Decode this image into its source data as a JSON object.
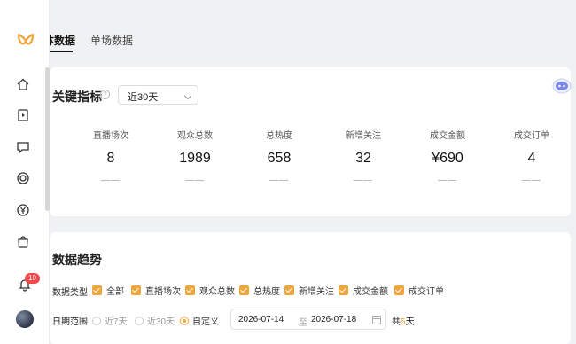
{
  "sidebar": {
    "nav_icons": [
      "home-icon",
      "play-icon",
      "message-icon",
      "target-icon",
      "yuan-icon",
      "shopping-bag-icon"
    ],
    "notification_count": "10"
  },
  "tabs": [
    {
      "label": "整体数据",
      "active": true
    },
    {
      "label": "单场数据",
      "active": false
    }
  ],
  "key_metrics": {
    "title": "关键指标",
    "period_select": "近30天",
    "items": [
      {
        "label": "直播场次",
        "value": "8",
        "change": "——"
      },
      {
        "label": "观众总数",
        "value": "1989",
        "change": "——"
      },
      {
        "label": "总热度",
        "value": "658",
        "change": "——"
      },
      {
        "label": "新增关注",
        "value": "32",
        "change": "——"
      },
      {
        "label": "成交金额",
        "value": "¥690",
        "change": "——"
      },
      {
        "label": "成交订单",
        "value": "4",
        "change": "——"
      }
    ]
  },
  "trend": {
    "title": "数据趋势",
    "type_label": "数据类型",
    "types": [
      {
        "label": "全部",
        "checked": true
      },
      {
        "label": "直播场次",
        "checked": true
      },
      {
        "label": "观众总数",
        "checked": true
      },
      {
        "label": "总热度",
        "checked": true
      },
      {
        "label": "新增关注",
        "checked": true
      },
      {
        "label": "成交金额",
        "checked": true
      },
      {
        "label": "成交订单",
        "checked": true
      }
    ],
    "range_label": "日期范围",
    "ranges": [
      {
        "label": "近7天",
        "checked": false
      },
      {
        "label": "近30天",
        "checked": false
      },
      {
        "label": "自定义",
        "checked": true
      }
    ],
    "date_start": "2026-07-14",
    "date_sep": "至",
    "date_end": "2026-07-18",
    "total_prefix": "共",
    "total_days": "5",
    "total_suffix": "天"
  },
  "colors": {
    "accent": "#f0a53a",
    "badge": "#f5484a"
  }
}
